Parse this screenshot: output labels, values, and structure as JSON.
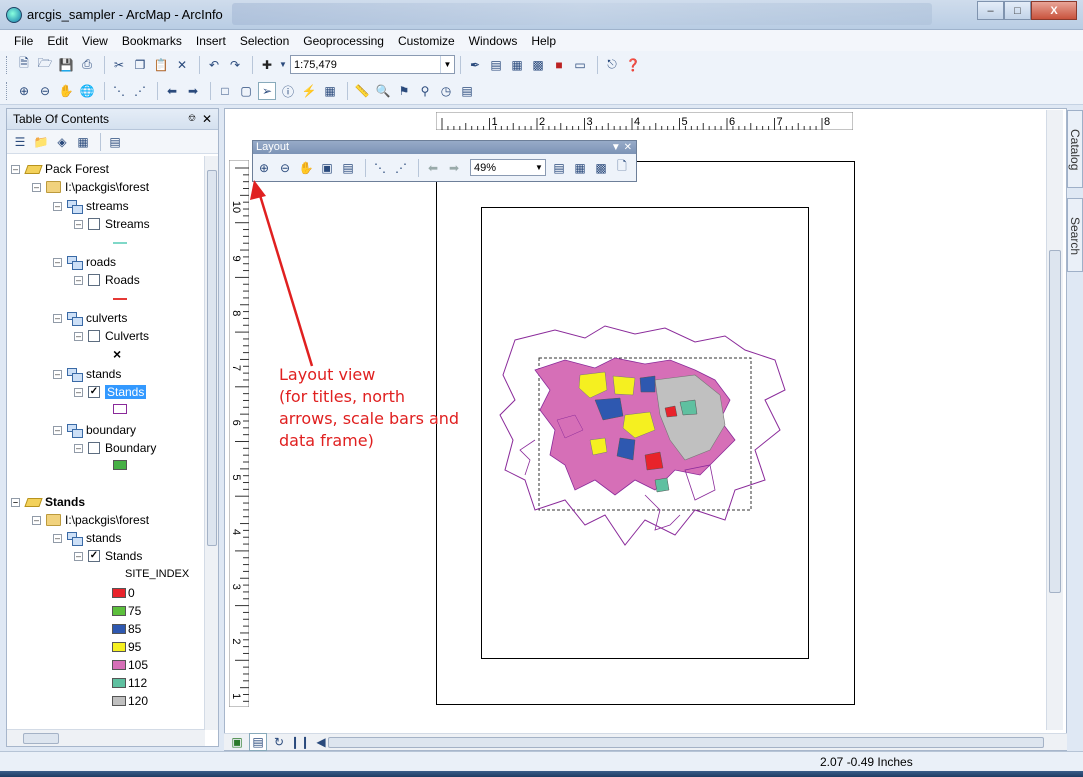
{
  "window": {
    "title": "arcgis_sampler - ArcMap - ArcInfo"
  },
  "menu": [
    "File",
    "Edit",
    "View",
    "Bookmarks",
    "Insert",
    "Selection",
    "Geoprocessing",
    "Customize",
    "Windows",
    "Help"
  ],
  "toolbar": {
    "scale_value": "1:75,479"
  },
  "toc": {
    "title": "Table Of Contents",
    "group1": {
      "name": "Pack Forest",
      "folder": "I:\\packgis\\forest",
      "layers": [
        {
          "name": "streams",
          "legend": "Streams",
          "checked": false,
          "symbol_color": "#7fd8c8"
        },
        {
          "name": "roads",
          "legend": "Roads",
          "checked": false,
          "symbol_color": "#e53935"
        },
        {
          "name": "culverts",
          "legend": "Culverts",
          "checked": false,
          "symbol": "×"
        },
        {
          "name": "stands",
          "legend": "Stands",
          "checked": true,
          "symbol_color": "#8a2a9a"
        },
        {
          "name": "boundary",
          "legend": "Boundary",
          "checked": false,
          "symbol_color": "#47b045"
        }
      ]
    },
    "group2": {
      "name": "Stands",
      "folder": "I:\\packgis\\forest",
      "layer": "stands",
      "legend": "Stands",
      "checked": true,
      "field": "SITE_INDEX",
      "classes": [
        {
          "label": "0",
          "color": "#e8232b"
        },
        {
          "label": "75",
          "color": "#5cbf3c"
        },
        {
          "label": "85",
          "color": "#2e58b0"
        },
        {
          "label": "95",
          "color": "#f5f020"
        },
        {
          "label": "105",
          "color": "#d66fb7"
        },
        {
          "label": "112",
          "color": "#5fc0a0"
        },
        {
          "label": "120",
          "color": "#c0c0c0"
        }
      ]
    }
  },
  "layout_toolbar": {
    "title": "Layout",
    "zoom": "49%"
  },
  "ruler": {
    "h_labels": [
      "1",
      "2",
      "3",
      "4",
      "5",
      "6",
      "7",
      "8"
    ],
    "v_labels": [
      "10",
      "9",
      "8",
      "7",
      "6",
      "5",
      "4",
      "3",
      "2",
      "1"
    ]
  },
  "annotation": "Layout view\n(for titles, north\narrows, scale bars and\ndata frame)",
  "dock": {
    "catalog": "Catalog",
    "search": "Search"
  },
  "status": {
    "coords": "2.07  -0.49 Inches"
  }
}
